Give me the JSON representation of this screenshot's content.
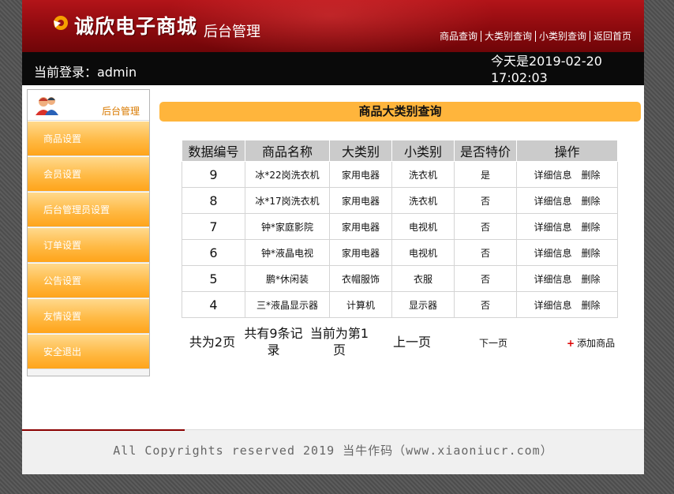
{
  "header": {
    "logo_text": "诚欣电子商城",
    "logo_sub": "后台管理",
    "nav": [
      "商品查询",
      "大类别查询",
      "小类别查询",
      "返回首页"
    ]
  },
  "bar": {
    "login": "当前登录：admin",
    "date": "今天是2019-02-20",
    "time": "17:02:03"
  },
  "sidebar": {
    "head_title": "后台管理",
    "items": [
      "商品设置",
      "会员设置",
      "后台管理员设置",
      "订单设置",
      "公告设置",
      "友情设置",
      "安全退出"
    ]
  },
  "main": {
    "title": "商品大类别查询",
    "columns": [
      "数据编号",
      "商品名称",
      "大类别",
      "小类别",
      "是否特价",
      "操作"
    ],
    "rows": [
      {
        "id": "9",
        "name": "冰*22岗洗衣机",
        "big": "家用电器",
        "small": "洗衣机",
        "special": "是"
      },
      {
        "id": "8",
        "name": "冰*17岗洗衣机",
        "big": "家用电器",
        "small": "洗衣机",
        "special": "否"
      },
      {
        "id": "7",
        "name": "钟*家庭影院",
        "big": "家用电器",
        "small": "电视机",
        "special": "否"
      },
      {
        "id": "6",
        "name": "钟*液晶电视",
        "big": "家用电器",
        "small": "电视机",
        "special": "否"
      },
      {
        "id": "5",
        "name": "鹏*休闲装",
        "big": "衣帽服饰",
        "small": "衣服",
        "special": "否"
      },
      {
        "id": "4",
        "name": "三*液晶显示器",
        "big": "计算机",
        "small": "显示器",
        "special": "否"
      }
    ],
    "op_detail": "详细信息",
    "op_delete": "删除",
    "pager": {
      "total_pages": "共为2页",
      "total_records": "共有9条记录",
      "current": "当前为第1页",
      "prev": "上一页",
      "next": "下一页"
    },
    "add_label": "添加商品"
  },
  "footer": {
    "copyright": "All Copyrights reserved 2019 当牛作码（www.xiaoniucr.com）"
  },
  "colors": {
    "header_red": "#9a0f13",
    "accent_orange": "#ffb53c",
    "bar_black": "#0a0a0a"
  }
}
